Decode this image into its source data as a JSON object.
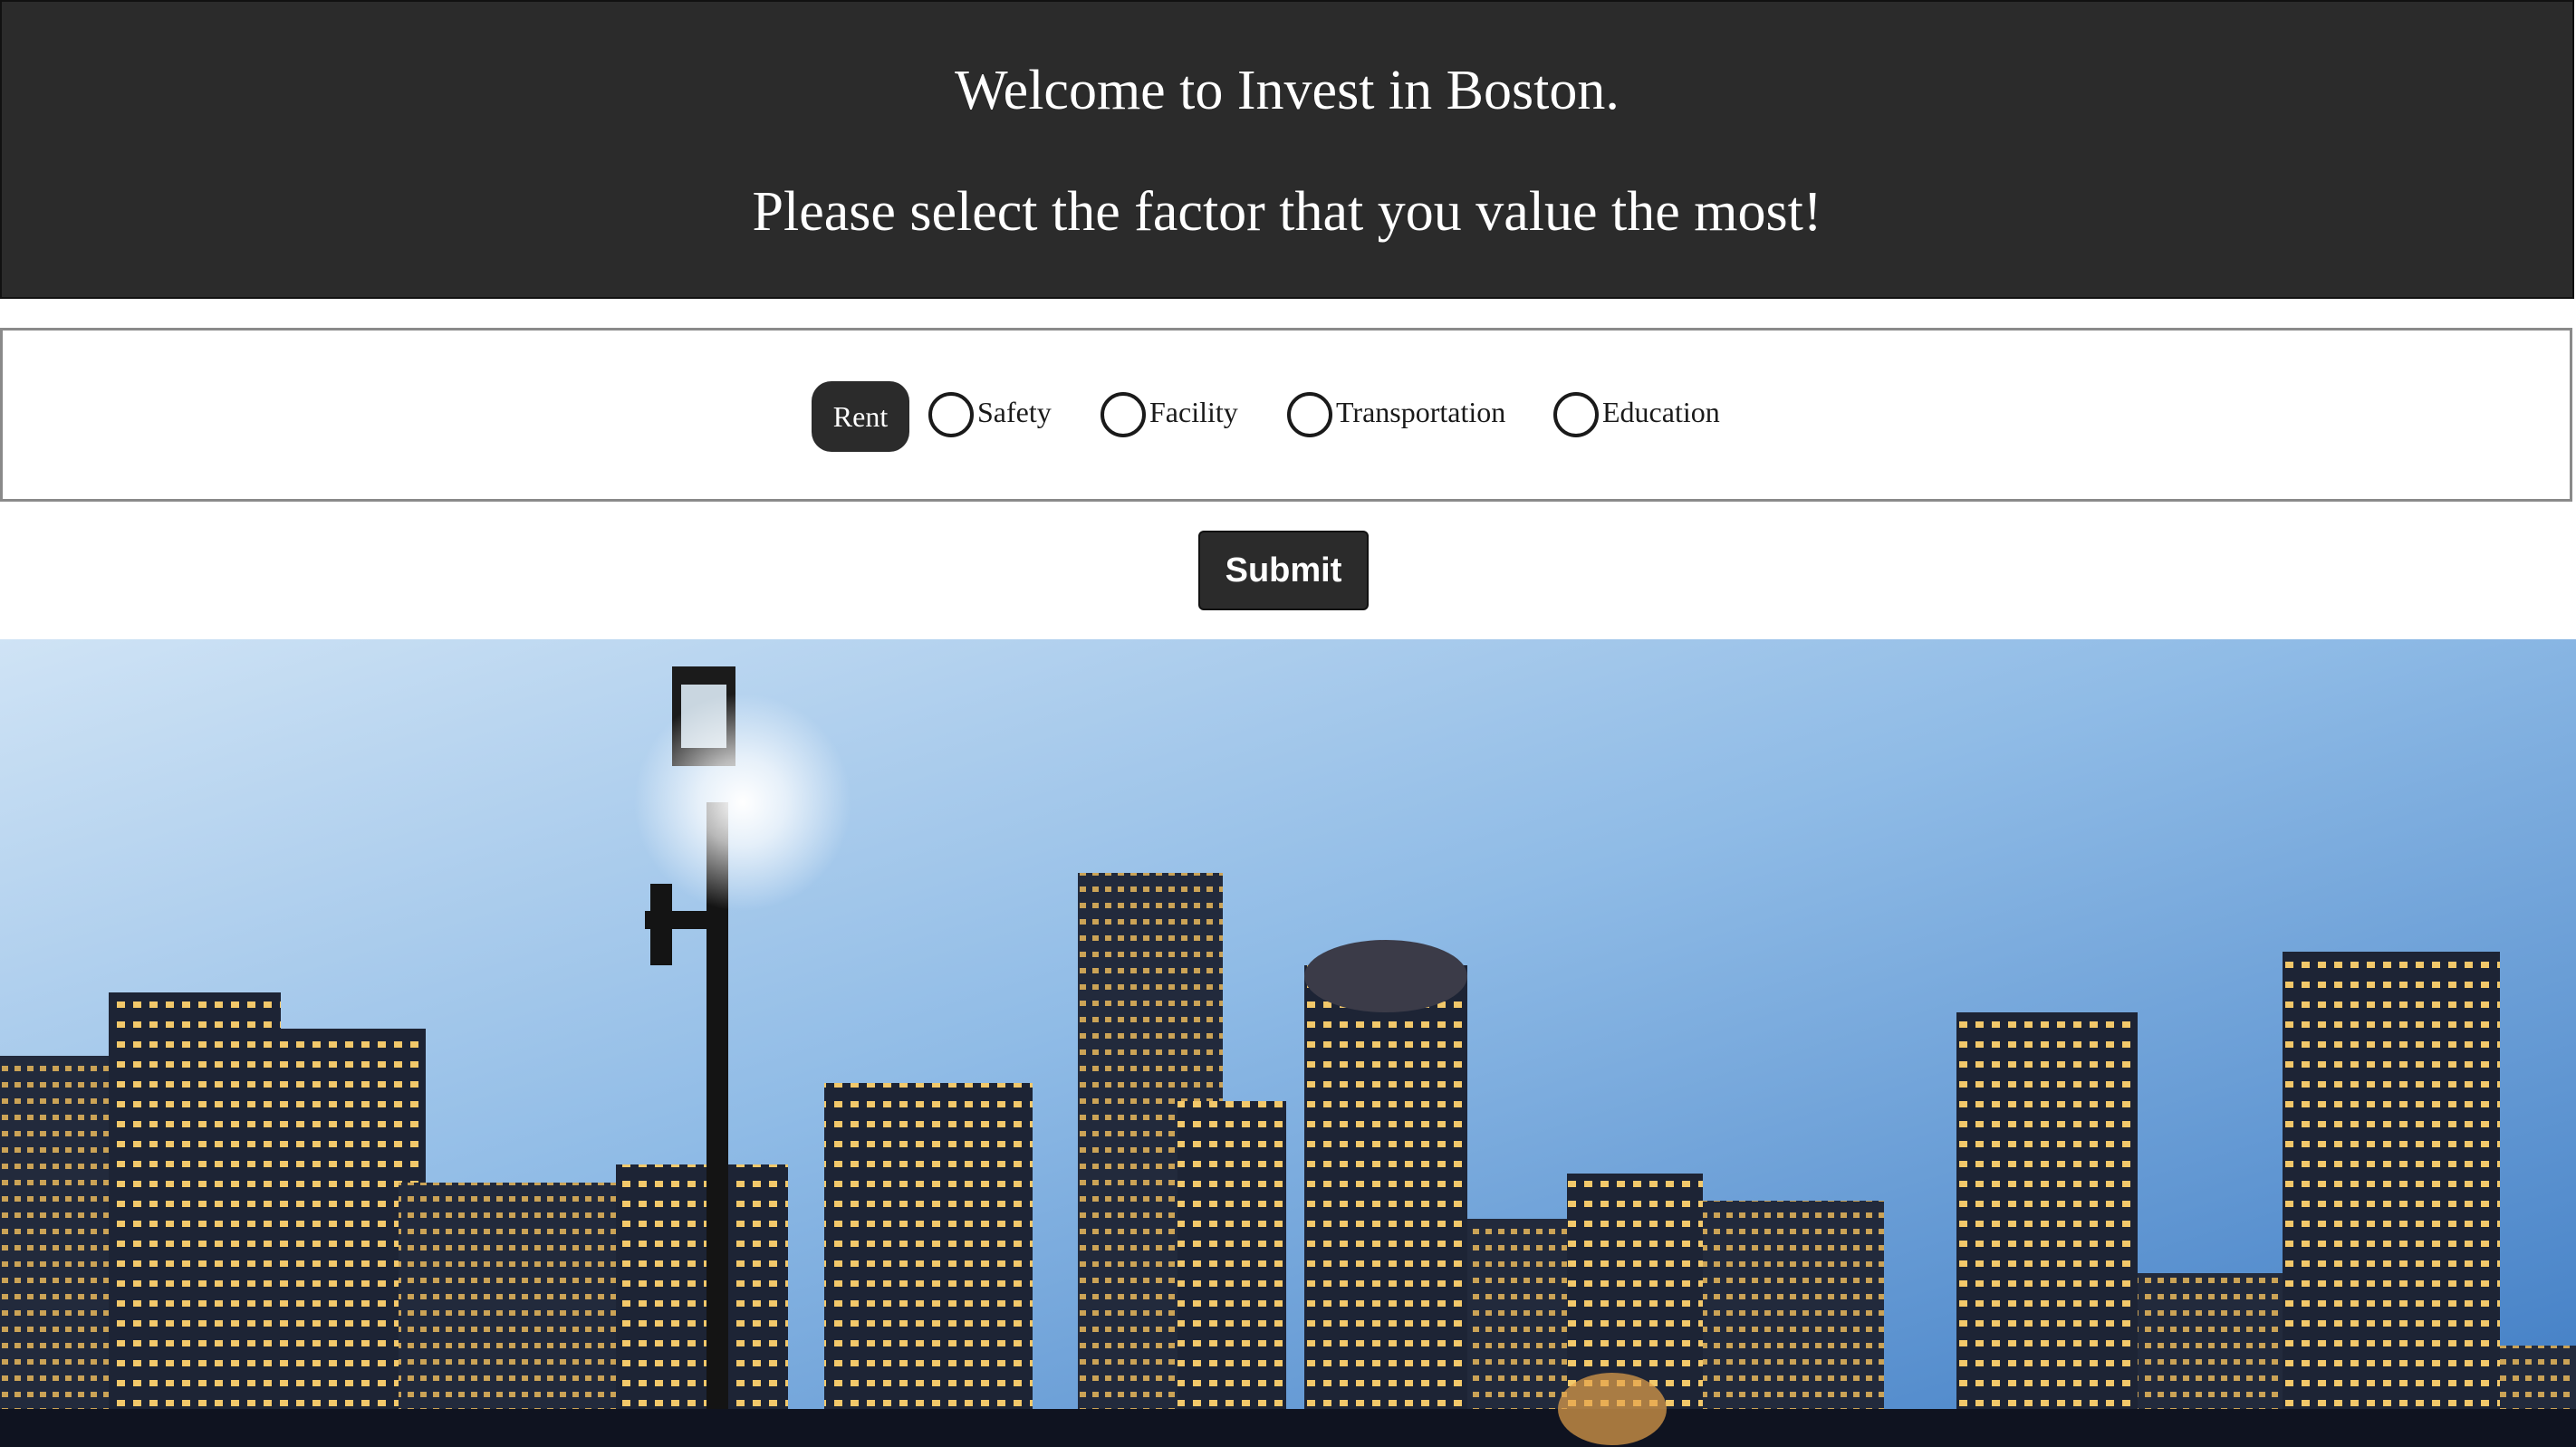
{
  "header": {
    "welcome_text": "Welcome to Invest in Boston.",
    "prompt_text": "Please select the factor that you value the most!"
  },
  "factors": {
    "selected": "Rent",
    "items": [
      {
        "label": "Rent",
        "selected": true
      },
      {
        "label": "Safety",
        "selected": false
      },
      {
        "label": "Facility",
        "selected": false
      },
      {
        "label": "Transportation",
        "selected": false
      },
      {
        "label": "Education",
        "selected": false
      }
    ]
  },
  "form": {
    "submit_label": "Submit"
  },
  "colors": {
    "header_bg": "#2b2b2b",
    "button_bg": "#2b2b2b",
    "text_light": "#ffffff"
  }
}
